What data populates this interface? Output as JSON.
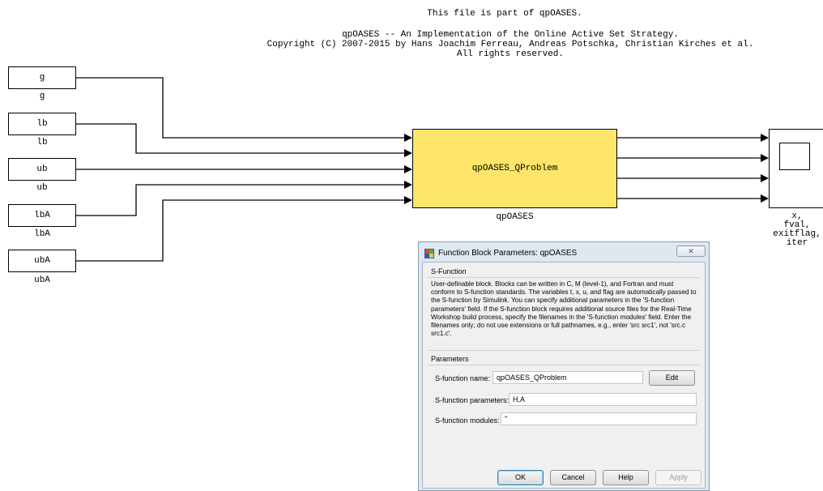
{
  "header": {
    "line1": "This file is part of qpOASES.",
    "line2": "qpOASES -- An Implementation of the Online Active Set Strategy.",
    "line3": "Copyright (C) 2007-2015 by Hans Joachim Ferreau, Andreas Potschka, Christian Kirches et al.",
    "line4": "All rights reserved."
  },
  "inputs": [
    {
      "name": "g",
      "label": "g"
    },
    {
      "name": "lb",
      "label": "lb"
    },
    {
      "name": "ub",
      "label": "ub"
    },
    {
      "name": "lbA",
      "label": "lbA"
    },
    {
      "name": "ubA",
      "label": "ubA"
    }
  ],
  "sfunction_block": {
    "text": "qpOASES_QProblem",
    "label": "qpOASES",
    "color": "#ffe569"
  },
  "output_block": {
    "label_lines": [
      "x,",
      "fval,",
      "exitflag,",
      "iter"
    ]
  },
  "dialog": {
    "title": "Function Block Parameters: qpOASES",
    "close_glyph": "✕",
    "section_sfunction": "S-Function",
    "description": "User-definable block.  Blocks can be written in C, M (level-1), and Fortran and must conform to S-function standards.  The variables t, x, u, and flag are automatically passed to the S-function by Simulink.  You can specify additional parameters in the 'S-function parameters' field. If the S-function block requires additional source files for the Real-Time Workshop build process, specify the filenames in the 'S-function modules' field. Enter the filenames only; do not use extensions or full pathnames, e.g., enter 'src src1', not 'src.c src1.c'.",
    "section_parameters": "Parameters",
    "fields": {
      "name_label": "S-function name:",
      "name_value": "qpOASES_QProblem",
      "edit_label": "Edit",
      "params_label": "S-function parameters:",
      "params_value": "H,A",
      "modules_label": "S-function modules:",
      "modules_value": "''"
    },
    "buttons": {
      "ok": "OK",
      "cancel": "Cancel",
      "help": "Help",
      "apply": "Apply"
    }
  }
}
